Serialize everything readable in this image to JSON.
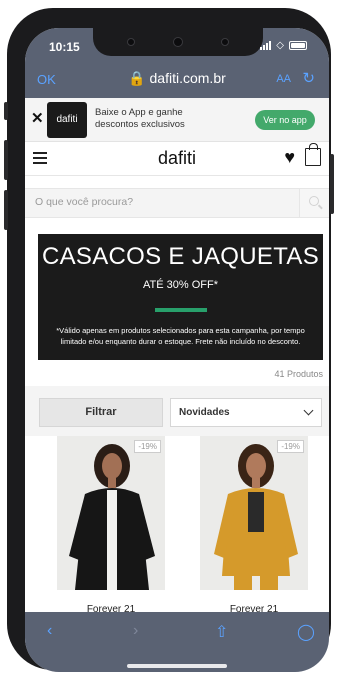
{
  "status": {
    "time": "10:15"
  },
  "browser": {
    "done_label": "OK",
    "url": "🔒 dafiti.com.br",
    "aa_label": "AA",
    "reload_icon": "reload-icon"
  },
  "app_banner": {
    "close_icon": "close-icon",
    "logo_text": "dafiti",
    "message": "Baixe o App e ganhe descontos exclusivos",
    "button_label": "Ver no app"
  },
  "header": {
    "brand": "dafiti",
    "menu_icon": "hamburger-icon",
    "wishlist_icon": "heart-icon",
    "cart_icon": "bag-icon"
  },
  "search": {
    "placeholder": "O que você procura?"
  },
  "promo": {
    "title": "CASACOS E JAQUETAS",
    "subtitle": "ATÉ 30% OFF*",
    "disclaimer": "*Válido apenas em produtos selecionados para esta campanha, por tempo limitado e/ou enquanto durar o estoque. Frete não incluído no desconto.",
    "accent_color": "#28a06b"
  },
  "results": {
    "count_text": "41 Produtos"
  },
  "controls": {
    "filter_label": "Filtrar",
    "sort_selected": "Novidades"
  },
  "products": [
    {
      "name": "Forever 21",
      "discount": "-19%",
      "jacket_color": "#161616"
    },
    {
      "name": "Forever 21",
      "discount": "-19%",
      "jacket_color": "#d59a2b"
    }
  ],
  "toolbar": {
    "back_icon": "chevron-left-icon",
    "forward_icon": "chevron-right-icon",
    "share_icon": "share-icon",
    "compass_icon": "compass-icon"
  }
}
